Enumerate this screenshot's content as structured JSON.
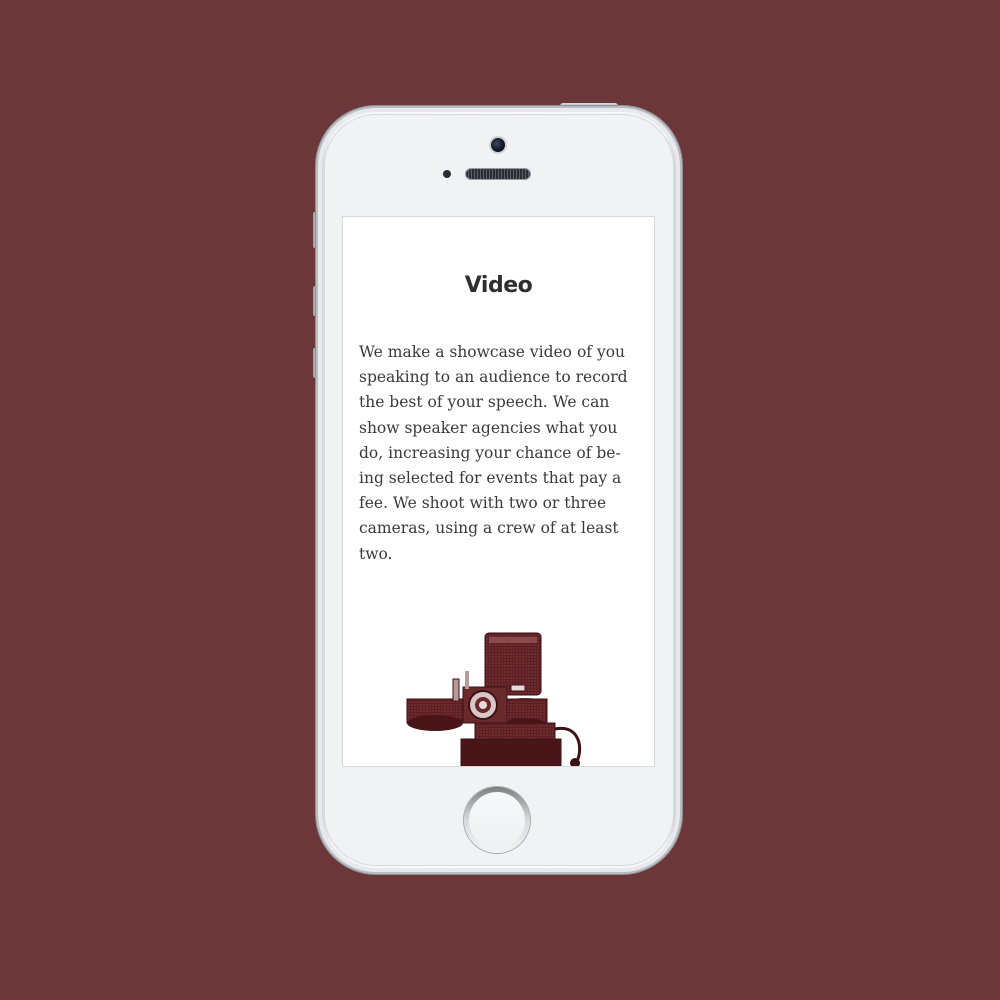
{
  "page": {
    "title": "Video",
    "description": "We make a showcase video of you\nspeaking to an audience to record\nthe best of your speech. We can\nshow speaker agencies what you\ndo, increasing your chance of be-\ning selected for events that pay a\nfee. We shoot with two or three\ncameras, using a crew of at least\ntwo."
  },
  "colors": {
    "background": "#6b3738",
    "accent": "#6a2a2c",
    "text": "#3a3a3c",
    "title": "#2f2f31"
  },
  "icons": {
    "illustration": "vintage-movie-projector-icon"
  }
}
